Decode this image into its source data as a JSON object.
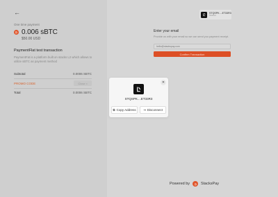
{
  "left": {
    "back_icon": "arrow-left-icon",
    "payment_label": "One time payment",
    "amount": "0.006 sBTC",
    "usd": "$50.00 USD",
    "tx_title": "PaymentFlat test transaction",
    "tx_desc": "PaymentFat is a platform built on stacks L2 which allows to utilize sBTC as payment method",
    "subtotal_label": "Subtotal",
    "subtotal_value": "0.0006 SBTC",
    "promo_label": "PROMO CODE",
    "promo_button": "Close ×",
    "total_label": "Total",
    "total_value": "0.0006 SBTC"
  },
  "wallet": {
    "address": "STQSPK....ET33R3",
    "network": "Testnet"
  },
  "email": {
    "title": "Enter your email",
    "desc": "Provide us with your email so we can send you payment receipt.",
    "placeholder": "hello@stackspay.com",
    "confirm_label": "Confirm Transaction"
  },
  "modal": {
    "address": "STQSPK....ET33R3",
    "copy_label": "Copy Address",
    "disconnect_label": "Disconnect",
    "close_icon": "close-icon"
  },
  "footer": {
    "powered_label": "Powered by",
    "brand": "StacksPay"
  },
  "colors": {
    "accent": "#dd4f25",
    "promo": "#d8642f"
  }
}
